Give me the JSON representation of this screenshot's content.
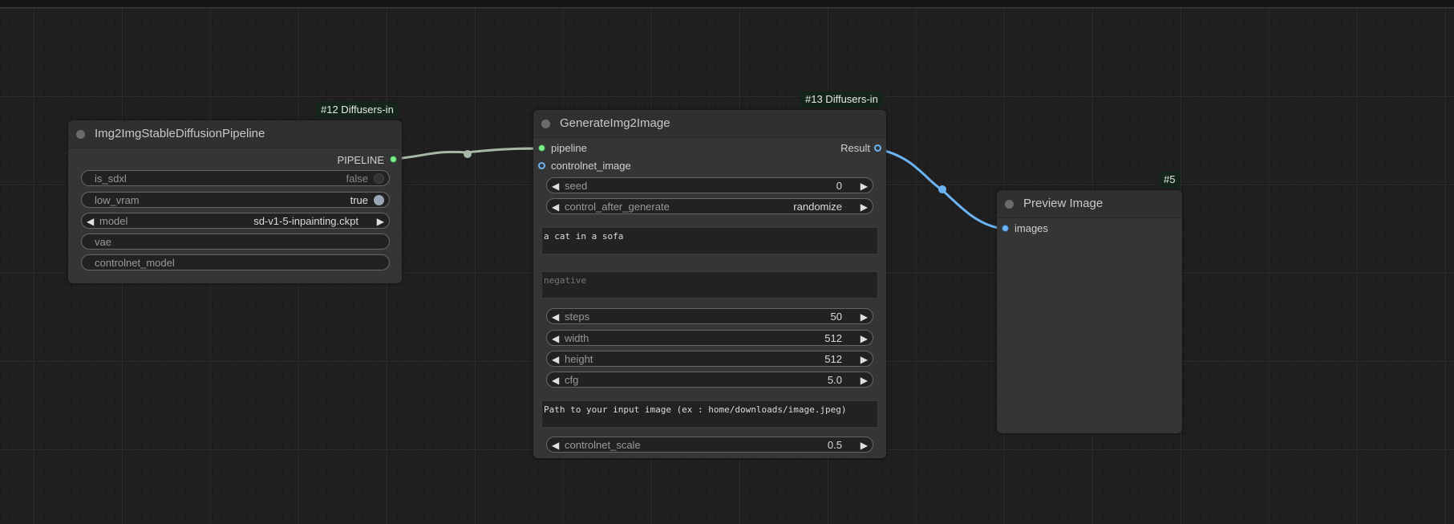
{
  "nodes": {
    "pipeline": {
      "badge": "#12 Diffusers-in",
      "title": "Img2ImgStableDiffusionPipeline",
      "output": "PIPELINE",
      "widgets": {
        "is_sdxl": {
          "label": "is_sdxl",
          "value": "false"
        },
        "low_vram": {
          "label": "low_vram",
          "value": "true"
        },
        "model": {
          "label": "model",
          "value": "sd-v1-5-inpainting.ckpt"
        },
        "vae": {
          "label": "vae"
        },
        "controlnet_model": {
          "label": "controlnet_model"
        }
      }
    },
    "generate": {
      "badge": "#13 Diffusers-in",
      "title": "GenerateImg2Image",
      "inputs": [
        "pipeline",
        "controlnet_image"
      ],
      "output": "Result",
      "widgets": {
        "seed": {
          "label": "seed",
          "value": "0"
        },
        "control_after_generate": {
          "label": "control_after_generate",
          "value": "randomize"
        },
        "prompt": "a cat in a sofa",
        "negative_placeholder": "negative",
        "steps": {
          "label": "steps",
          "value": "50"
        },
        "width": {
          "label": "width",
          "value": "512"
        },
        "height": {
          "label": "height",
          "value": "512"
        },
        "cfg": {
          "label": "cfg",
          "value": "5.0"
        },
        "image_path_placeholder": "Path to your input image (ex : home/downloads/image.jpeg)",
        "controlnet_scale": {
          "label": "controlnet_scale",
          "value": "0.5"
        }
      }
    },
    "preview": {
      "badge": "#5",
      "title": "Preview Image",
      "input": "images"
    }
  },
  "arrows": {
    "left": "◀",
    "right": "▶"
  },
  "colors": {
    "canvas": "#202020",
    "node_body": "#353535",
    "pipeline_link": "#a8b8a8",
    "image_link": "#6cb4f4",
    "slot_green": "#7bef8a",
    "slot_blue": "#6cb4f4"
  }
}
